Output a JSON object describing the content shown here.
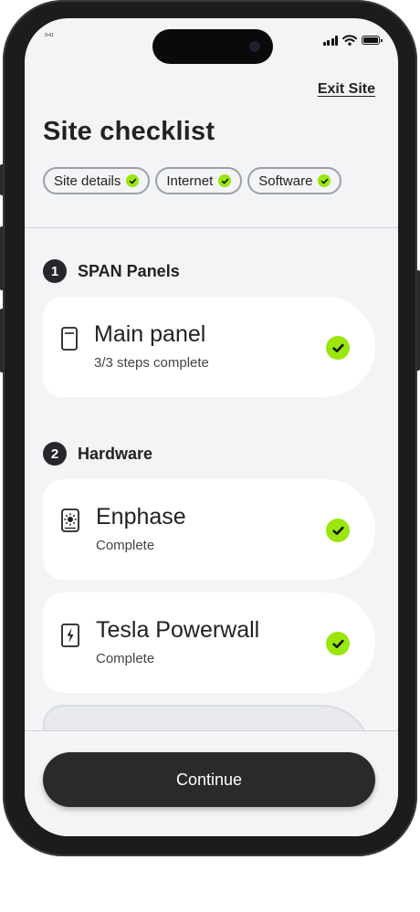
{
  "status_bar": {
    "time": "9:41"
  },
  "header": {
    "exit_label": "Exit Site",
    "title": "Site checklist"
  },
  "chips": [
    {
      "label": "Site details",
      "complete": true
    },
    {
      "label": "Internet",
      "complete": true
    },
    {
      "label": "Software",
      "complete": true
    }
  ],
  "sections": [
    {
      "number": "1",
      "title": "SPAN Panels",
      "items": [
        {
          "title": "Main panel",
          "subtitle": "3/3 steps complete",
          "icon": "panel-icon",
          "complete": true
        }
      ]
    },
    {
      "number": "2",
      "title": "Hardware",
      "items": [
        {
          "title": "Enphase",
          "subtitle": "Complete",
          "icon": "solar-inverter-icon",
          "complete": true
        },
        {
          "title": "Tesla Powerwall",
          "subtitle": "Complete",
          "icon": "battery-bolt-icon",
          "complete": true
        }
      ]
    }
  ],
  "footer": {
    "continue_label": "Continue"
  },
  "colors": {
    "accent": "#9be60d",
    "dark": "#2a2a2c",
    "background": "#f3f4f6"
  }
}
